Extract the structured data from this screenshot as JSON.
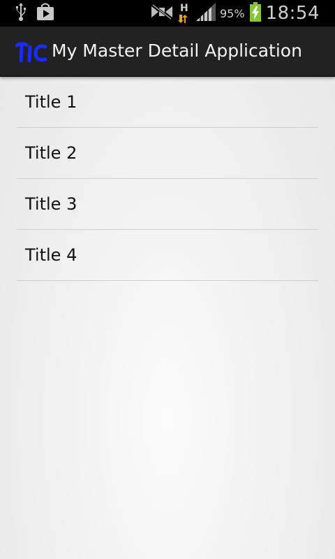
{
  "status_bar": {
    "icons_left": [
      "usb-icon",
      "play-store-icon"
    ],
    "icons_right": [
      "no-sim-icon",
      "hspa-data-icon",
      "signal-icon",
      "battery-charging-icon"
    ],
    "network_type": "H",
    "battery_percent": "95%",
    "time": "18:54"
  },
  "action_bar": {
    "logo_text": "TIC",
    "title": "My Master Detail Application"
  },
  "list": {
    "items": [
      {
        "label": "Title 1"
      },
      {
        "label": "Title 2"
      },
      {
        "label": "Title 3"
      },
      {
        "label": "Title 4"
      }
    ]
  },
  "colors": {
    "status_bar_bg": "#000000",
    "action_bar_bg": "#222222",
    "logo_blue": "#1a2cff",
    "charge_green": "#8ac43f",
    "arrow_orange": "#f0a020",
    "divider": "#cfcfcf"
  }
}
